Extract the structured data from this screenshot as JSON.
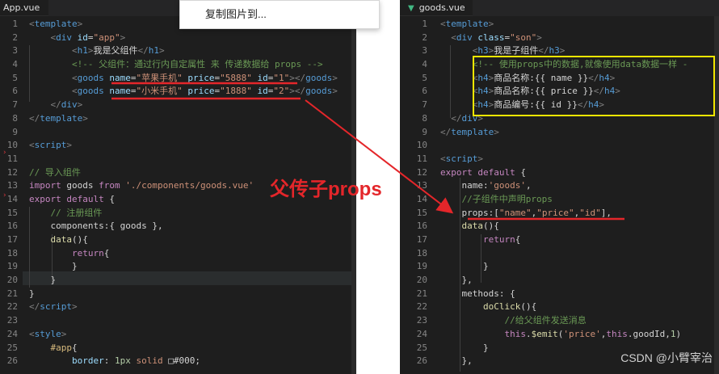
{
  "left_editor": {
    "tab_label": "App.vue",
    "lines": [
      {
        "n": "1",
        "parts": [
          [
            "t-punc",
            "<"
          ],
          [
            "t-tag",
            "template"
          ],
          [
            "t-punc",
            ">"
          ]
        ]
      },
      {
        "n": "2",
        "parts": [
          [
            "t-ident",
            "    "
          ],
          [
            "t-punc",
            "<"
          ],
          [
            "t-tag",
            "div "
          ],
          [
            "t-attr",
            "id"
          ],
          [
            "t-ident",
            "="
          ],
          [
            "t-str",
            "\"app\""
          ],
          [
            "t-punc",
            ">"
          ]
        ]
      },
      {
        "n": "3",
        "parts": [
          [
            "t-ident",
            "        "
          ],
          [
            "t-punc",
            "<"
          ],
          [
            "t-tag",
            "h1"
          ],
          [
            "t-punc",
            ">"
          ],
          [
            "t-ident",
            "我是父组件"
          ],
          [
            "t-punc",
            "</"
          ],
          [
            "t-tag",
            "h1"
          ],
          [
            "t-punc",
            ">"
          ]
        ]
      },
      {
        "n": "4",
        "parts": [
          [
            "t-ident",
            "        "
          ],
          [
            "t-cmt",
            "<!-- 父组件：通过行内自定属性 来 传递数据给 props -->"
          ]
        ]
      },
      {
        "n": "5",
        "parts": [
          [
            "t-ident",
            "        "
          ],
          [
            "t-punc",
            "<"
          ],
          [
            "t-tag",
            "goods "
          ],
          [
            "t-attr",
            "name"
          ],
          [
            "t-ident",
            "="
          ],
          [
            "t-str",
            "\"苹果手机\" "
          ],
          [
            "t-attr",
            "price"
          ],
          [
            "t-ident",
            "="
          ],
          [
            "t-str",
            "\"5888\" "
          ],
          [
            "t-attr",
            "id"
          ],
          [
            "t-ident",
            "="
          ],
          [
            "t-str",
            "\"1\""
          ],
          [
            "t-punc",
            "></"
          ],
          [
            "t-tag",
            "goods"
          ],
          [
            "t-punc",
            ">"
          ]
        ]
      },
      {
        "n": "6",
        "parts": [
          [
            "t-ident",
            "        "
          ],
          [
            "t-punc",
            "<"
          ],
          [
            "t-tag",
            "goods "
          ],
          [
            "t-attr",
            "name"
          ],
          [
            "t-ident",
            "="
          ],
          [
            "t-str",
            "\"小米手机\" "
          ],
          [
            "t-attr",
            "price"
          ],
          [
            "t-ident",
            "="
          ],
          [
            "t-str",
            "\"1888\" "
          ],
          [
            "t-attr",
            "id"
          ],
          [
            "t-ident",
            "="
          ],
          [
            "t-str",
            "\"2\""
          ],
          [
            "t-punc",
            "></"
          ],
          [
            "t-tag",
            "goods"
          ],
          [
            "t-punc",
            ">"
          ]
        ]
      },
      {
        "n": "7",
        "parts": [
          [
            "t-ident",
            "    "
          ],
          [
            "t-punc",
            "</"
          ],
          [
            "t-tag",
            "div"
          ],
          [
            "t-punc",
            ">"
          ]
        ]
      },
      {
        "n": "8",
        "parts": [
          [
            "t-punc",
            "</"
          ],
          [
            "t-tag",
            "template"
          ],
          [
            "t-punc",
            ">"
          ]
        ]
      },
      {
        "n": "9",
        "parts": []
      },
      {
        "n": "10",
        "parts": [
          [
            "t-punc",
            "<"
          ],
          [
            "t-tag",
            "script"
          ],
          [
            "t-punc",
            ">"
          ]
        ]
      },
      {
        "n": "11",
        "parts": []
      },
      {
        "n": "12",
        "parts": [
          [
            "t-cmt",
            "// 导入组件"
          ]
        ]
      },
      {
        "n": "13",
        "parts": [
          [
            "t-kw",
            "import "
          ],
          [
            "t-ident",
            "goods "
          ],
          [
            "t-kw",
            "from "
          ],
          [
            "t-str",
            "'./components/goods.vue'"
          ]
        ]
      },
      {
        "n": "14",
        "parts": [
          [
            "t-kw",
            "export default "
          ],
          [
            "t-ident",
            "{"
          ]
        ]
      },
      {
        "n": "15",
        "parts": [
          [
            "t-ident",
            "    "
          ],
          [
            "t-cmt",
            "// 注册组件"
          ]
        ]
      },
      {
        "n": "16",
        "parts": [
          [
            "t-ident",
            "    components:{ goods },"
          ]
        ]
      },
      {
        "n": "17",
        "parts": [
          [
            "t-ident",
            "    "
          ],
          [
            "t-fn",
            "data"
          ],
          [
            "t-ident",
            "(){"
          ]
        ]
      },
      {
        "n": "18",
        "parts": [
          [
            "t-ident",
            "        "
          ],
          [
            "t-kw",
            "return"
          ],
          [
            "t-ident",
            "{"
          ]
        ]
      },
      {
        "n": "19",
        "parts": [
          [
            "t-ident",
            "        }"
          ]
        ]
      },
      {
        "n": "20",
        "parts": [
          [
            "t-ident",
            "    }"
          ]
        ]
      },
      {
        "n": "21",
        "parts": [
          [
            "t-ident",
            "}"
          ]
        ]
      },
      {
        "n": "22",
        "parts": [
          [
            "t-punc",
            "</"
          ],
          [
            "t-tag",
            "script"
          ],
          [
            "t-punc",
            ">"
          ]
        ]
      },
      {
        "n": "23",
        "parts": []
      },
      {
        "n": "24",
        "parts": [
          [
            "t-punc",
            "<"
          ],
          [
            "t-tag",
            "style"
          ],
          [
            "t-punc",
            ">"
          ]
        ]
      },
      {
        "n": "25",
        "parts": [
          [
            "t-ident",
            "    "
          ],
          [
            "t-css",
            "#app"
          ],
          [
            "t-ident",
            "{"
          ]
        ]
      },
      {
        "n": "26",
        "parts": [
          [
            "t-ident",
            "        "
          ],
          [
            "t-attr",
            "border"
          ],
          [
            "t-ident",
            ": "
          ],
          [
            "t-num",
            "1px "
          ],
          [
            "t-str",
            "solid "
          ],
          [
            "t-ident",
            "□#000;"
          ]
        ]
      }
    ]
  },
  "right_editor": {
    "tab_label": "goods.vue",
    "lines": [
      {
        "n": "1",
        "parts": [
          [
            "t-punc",
            "<"
          ],
          [
            "t-tag",
            "template"
          ],
          [
            "t-punc",
            ">"
          ]
        ]
      },
      {
        "n": "2",
        "parts": [
          [
            "t-ident",
            "  "
          ],
          [
            "t-punc",
            "<"
          ],
          [
            "t-tag",
            "div "
          ],
          [
            "t-attr",
            "class"
          ],
          [
            "t-ident",
            "="
          ],
          [
            "t-str",
            "\"son\""
          ],
          [
            "t-punc",
            ">"
          ]
        ]
      },
      {
        "n": "3",
        "parts": [
          [
            "t-ident",
            "      "
          ],
          [
            "t-punc",
            "<"
          ],
          [
            "t-tag",
            "h3"
          ],
          [
            "t-punc",
            ">"
          ],
          [
            "t-ident",
            "我是子组件"
          ],
          [
            "t-punc",
            "</"
          ],
          [
            "t-tag",
            "h3"
          ],
          [
            "t-punc",
            ">"
          ]
        ]
      },
      {
        "n": "4",
        "parts": [
          [
            "t-ident",
            "      "
          ],
          [
            "t-cmt",
            "<!-- 使用props中的数据,就像使用data数据一样 -"
          ]
        ]
      },
      {
        "n": "5",
        "parts": [
          [
            "t-ident",
            "      "
          ],
          [
            "t-punc",
            "<"
          ],
          [
            "t-tag",
            "h4"
          ],
          [
            "t-punc",
            ">"
          ],
          [
            "t-ident",
            "商品名称:{{ name }}"
          ],
          [
            "t-punc",
            "</"
          ],
          [
            "t-tag",
            "h4"
          ],
          [
            "t-punc",
            ">"
          ]
        ]
      },
      {
        "n": "6",
        "parts": [
          [
            "t-ident",
            "      "
          ],
          [
            "t-punc",
            "<"
          ],
          [
            "t-tag",
            "h4"
          ],
          [
            "t-punc",
            ">"
          ],
          [
            "t-ident",
            "商品名称:{{ price }}"
          ],
          [
            "t-punc",
            "</"
          ],
          [
            "t-tag",
            "h4"
          ],
          [
            "t-punc",
            ">"
          ]
        ]
      },
      {
        "n": "7",
        "parts": [
          [
            "t-ident",
            "      "
          ],
          [
            "t-punc",
            "<"
          ],
          [
            "t-tag",
            "h4"
          ],
          [
            "t-punc",
            ">"
          ],
          [
            "t-ident",
            "商品编号:{{ id }}"
          ],
          [
            "t-punc",
            "</"
          ],
          [
            "t-tag",
            "h4"
          ],
          [
            "t-punc",
            ">"
          ]
        ]
      },
      {
        "n": "8",
        "parts": [
          [
            "t-ident",
            "  "
          ],
          [
            "t-punc",
            "</"
          ],
          [
            "t-tag",
            "div"
          ],
          [
            "t-punc",
            ">"
          ]
        ]
      },
      {
        "n": "9",
        "parts": [
          [
            "t-punc",
            "</"
          ],
          [
            "t-tag",
            "template"
          ],
          [
            "t-punc",
            ">"
          ]
        ]
      },
      {
        "n": "10",
        "parts": []
      },
      {
        "n": "11",
        "parts": [
          [
            "t-punc",
            "<"
          ],
          [
            "t-tag",
            "script"
          ],
          [
            "t-punc",
            ">"
          ]
        ]
      },
      {
        "n": "12",
        "parts": [
          [
            "t-kw",
            "export default "
          ],
          [
            "t-ident",
            "{"
          ]
        ]
      },
      {
        "n": "13",
        "parts": [
          [
            "t-ident",
            "    name:"
          ],
          [
            "t-str",
            "'goods'"
          ],
          [
            "t-ident",
            ","
          ]
        ]
      },
      {
        "n": "14",
        "parts": [
          [
            "t-ident",
            "    "
          ],
          [
            "t-cmt",
            "//子组件中声明props"
          ]
        ]
      },
      {
        "n": "15",
        "parts": [
          [
            "t-ident",
            "    props:["
          ],
          [
            "t-str",
            "\"name\""
          ],
          [
            "t-ident",
            ","
          ],
          [
            "t-str",
            "\"price\""
          ],
          [
            "t-ident",
            ","
          ],
          [
            "t-str",
            "\"id\""
          ],
          [
            "t-ident",
            "],"
          ]
        ]
      },
      {
        "n": "16",
        "parts": [
          [
            "t-ident",
            "    "
          ],
          [
            "t-fn",
            "data"
          ],
          [
            "t-ident",
            "(){"
          ]
        ]
      },
      {
        "n": "17",
        "parts": [
          [
            "t-ident",
            "        "
          ],
          [
            "t-kw",
            "return"
          ],
          [
            "t-ident",
            "{"
          ]
        ]
      },
      {
        "n": "18",
        "parts": []
      },
      {
        "n": "19",
        "parts": [
          [
            "t-ident",
            "        }"
          ]
        ]
      },
      {
        "n": "20",
        "parts": [
          [
            "t-ident",
            "    },"
          ]
        ]
      },
      {
        "n": "21",
        "parts": [
          [
            "t-ident",
            "    methods: {"
          ]
        ]
      },
      {
        "n": "22",
        "parts": [
          [
            "t-ident",
            "        "
          ],
          [
            "t-fn",
            "doClick"
          ],
          [
            "t-ident",
            "(){"
          ]
        ]
      },
      {
        "n": "23",
        "parts": [
          [
            "t-ident",
            "            "
          ],
          [
            "t-cmt",
            "//给父组件发送消息"
          ]
        ]
      },
      {
        "n": "24",
        "parts": [
          [
            "t-ident",
            "            "
          ],
          [
            "t-kw",
            "this"
          ],
          [
            "t-ident",
            "."
          ],
          [
            "t-fn",
            "$emit"
          ],
          [
            "t-ident",
            "("
          ],
          [
            "t-str",
            "'price'"
          ],
          [
            "t-ident",
            ","
          ],
          [
            "t-kw",
            "this"
          ],
          [
            "t-ident",
            ".goodId,"
          ],
          [
            "t-num",
            "1"
          ],
          [
            "t-ident",
            ")"
          ]
        ]
      },
      {
        "n": "25",
        "parts": [
          [
            "t-ident",
            "        }"
          ]
        ]
      },
      {
        "n": "26",
        "parts": [
          [
            "t-ident",
            "    },"
          ]
        ]
      }
    ]
  },
  "context_menu": {
    "copy_image_label": "复制图片到..."
  },
  "annotation": {
    "label": "父传子props",
    "color": "#e4262a",
    "highlight_color": "#f2e600"
  },
  "watermark": {
    "text": "CSDN @小臂宰治"
  }
}
